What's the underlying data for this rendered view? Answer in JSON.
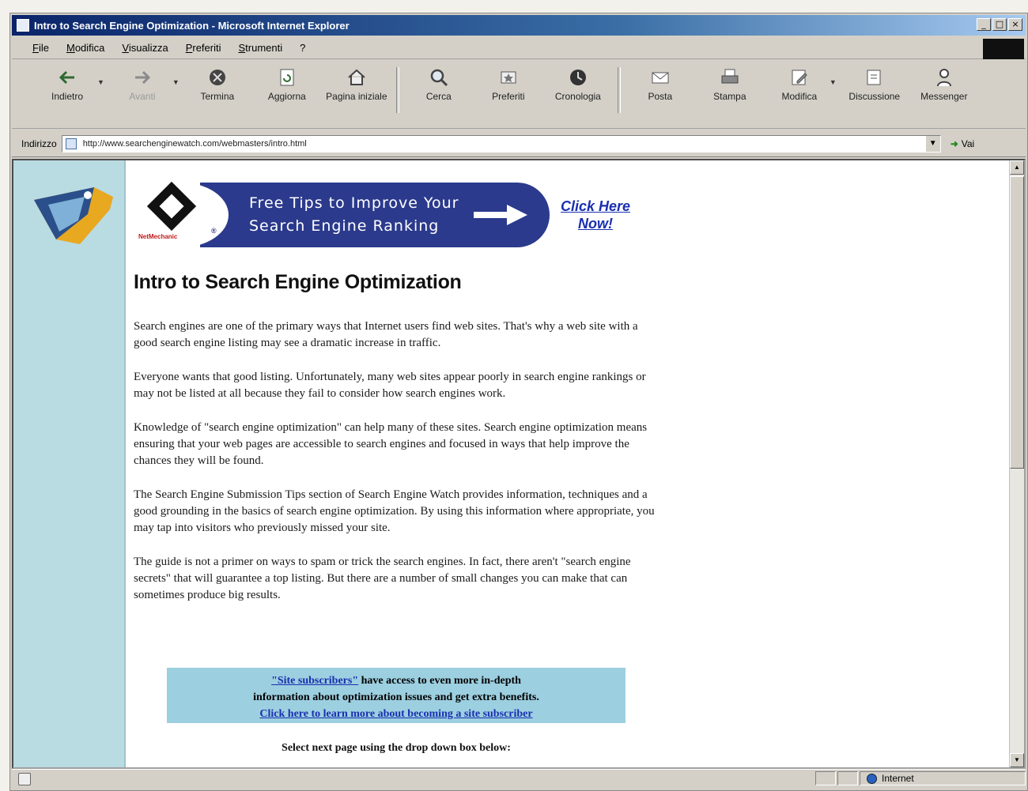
{
  "window": {
    "title": "Intro to Search Engine Optimization - Microsoft Internet Explorer",
    "controls": [
      "_",
      "□",
      "×"
    ]
  },
  "menubar": {
    "items": [
      "File",
      "Modifica",
      "Visualizza",
      "Preferiti",
      "Strumenti",
      "?"
    ]
  },
  "toolbar": {
    "buttons": [
      {
        "label": "Indietro",
        "icon": "back-arrow-icon"
      },
      {
        "label": "Avanti",
        "icon": "forward-arrow-icon"
      },
      {
        "label": "Termina",
        "icon": "stop-icon"
      },
      {
        "label": "Aggiorna",
        "icon": "refresh-icon"
      },
      {
        "label": "Pagina iniziale",
        "icon": "home-icon"
      },
      {
        "label": "Cerca",
        "icon": "search-icon"
      },
      {
        "label": "Preferiti",
        "icon": "favorites-icon"
      },
      {
        "label": "Cronologia",
        "icon": "history-icon"
      },
      {
        "label": "Posta",
        "icon": "mail-icon"
      },
      {
        "label": "Stampa",
        "icon": "print-icon"
      },
      {
        "label": "Modifica",
        "icon": "edit-icon"
      },
      {
        "label": "Discussione",
        "icon": "discuss-icon"
      },
      {
        "label": "Messenger",
        "icon": "messenger-icon"
      }
    ]
  },
  "addressbar": {
    "label": "Indirizzo",
    "url": "http://www.searchenginewatch.com/webmasters/intro.html",
    "go_label": "Vai"
  },
  "page": {
    "banner": {
      "brand": "NetMechanic",
      "line1": "Free Tips to Improve Your",
      "line2": "Search Engine Ranking",
      "cta_line1": "Click Here",
      "cta_line2": "Now!"
    },
    "title": "Intro to Search Engine Optimization",
    "paragraphs": [
      "Search engines are one of the primary ways that Internet users find web sites. That's why a web site with a good search engine listing may see a dramatic increase in traffic.",
      "Everyone wants that good listing. Unfortunately, many web sites appear poorly in search engine rankings or may not be listed at all because they fail to consider how search engines work.",
      "Knowledge of \"search engine optimization\" can help many of these sites. Search engine optimization means ensuring that your web pages are accessible to search engines and focused in ways that help improve the chances they will be found.",
      "The Search Engine Submission Tips section of Search Engine Watch provides information, techniques and a good grounding in the basics of search engine optimization. By using this information where appropriate, you may tap into visitors who previously missed your site.",
      "The guide is not a primer on ways to spam or trick the search engines. In fact, there aren't \"search engine secrets\" that will guarantee a top listing. But there are a number of small changes you can make that can sometimes produce big results."
    ],
    "subscriber_box": {
      "link1": "\"Site subscribers\"",
      "text1": " have access to even more in-depth",
      "text2": "information about optimization issues and get extra benefits.",
      "link2": "Click here to learn more about becoming a site subscriber"
    },
    "select_label": "Select next page using the drop down box below:"
  },
  "statusbar": {
    "zone": "Internet"
  }
}
